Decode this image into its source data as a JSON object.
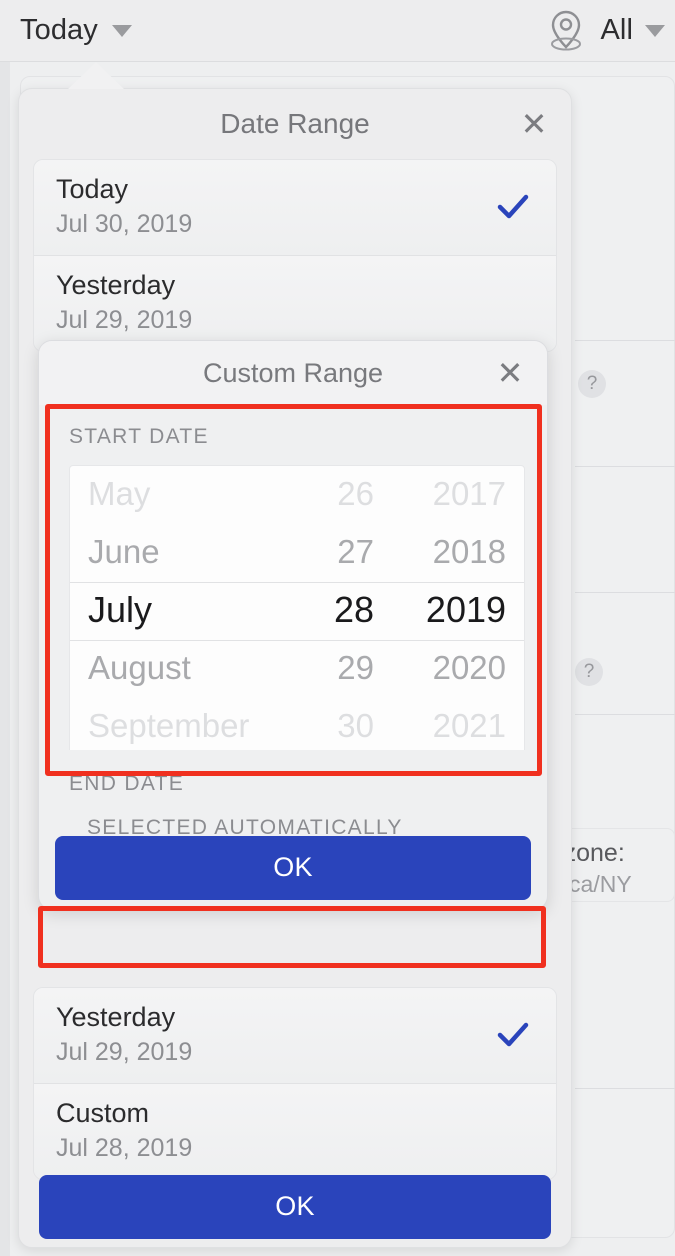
{
  "topbar": {
    "date_filter_label": "Today",
    "date_filter_caret": "chevron-down-icon",
    "location_icon": "location-pin-icon",
    "location_filter_label": "All",
    "location_caret": "chevron-down-icon"
  },
  "background": {
    "help_icon_1": "?",
    "help_icon_2": "?",
    "timezone_label": "Timezone:",
    "timezone_value": "America/NY"
  },
  "popup": {
    "title": "Date Range",
    "close_icon": "close-icon",
    "items_top": [
      {
        "title": "Today",
        "sub": "Jul 30, 2019",
        "checked": true
      },
      {
        "title": "Yesterday",
        "sub": "Jul 29, 2019",
        "checked": false
      }
    ],
    "items_bottom": [
      {
        "title": "Yesterday",
        "sub": "Jul 29, 2019",
        "checked": true
      },
      {
        "title": "Custom",
        "sub": "Jul 28, 2019",
        "checked": false
      }
    ],
    "ok_label": "OK"
  },
  "modal": {
    "title": "Custom Range",
    "close_icon": "close-icon",
    "start_label": "START DATE",
    "end_label": "END DATE",
    "end_auto_text": "SELECTED AUTOMATICALLY",
    "ok_label": "OK",
    "picker": {
      "months": [
        "May",
        "June",
        "July",
        "August",
        "September"
      ],
      "days": [
        "26",
        "27",
        "28",
        "29",
        "30"
      ],
      "years": [
        "2017",
        "2018",
        "2019",
        "2020",
        "2021"
      ],
      "selected_index": 2,
      "selected_month": "July",
      "selected_day": "28",
      "selected_year": "2019"
    }
  },
  "colors": {
    "accent_blue": "#2a44bb",
    "check_blue": "#2a44bb",
    "highlight_red": "#f0301f",
    "panel_gray": "#eeeff0"
  }
}
